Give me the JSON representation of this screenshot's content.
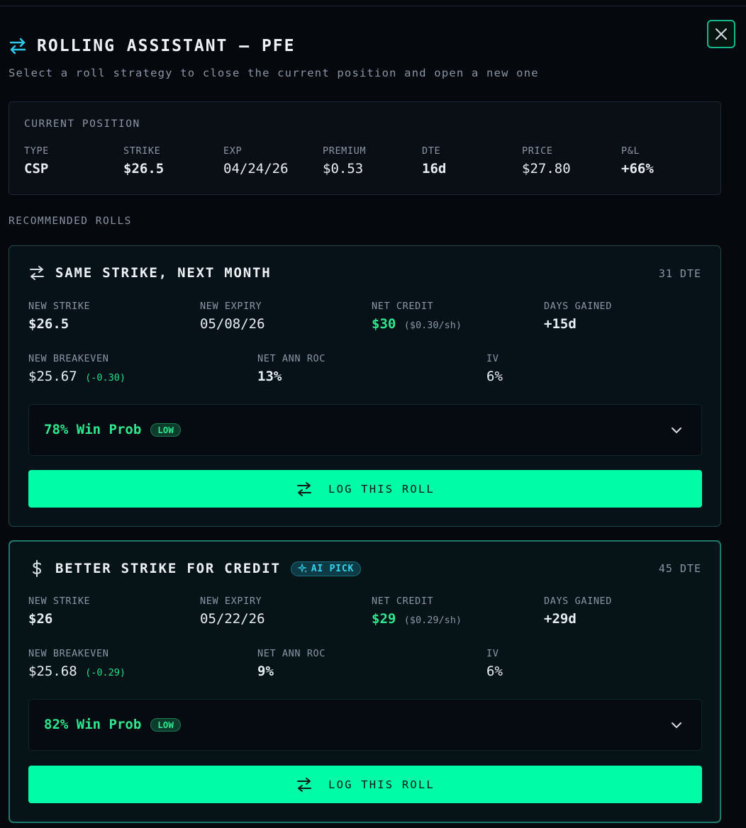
{
  "header": {
    "title": "ROLLING ASSISTANT — PFE",
    "subtitle": "Select a roll strategy to close the current position and open a new one"
  },
  "current_position": {
    "label": "CURRENT POSITION",
    "fields": [
      {
        "key": "TYPE",
        "value": "CSP"
      },
      {
        "key": "STRIKE",
        "value": "$26.5"
      },
      {
        "key": "EXP",
        "value": "04/24/26"
      },
      {
        "key": "PREMIUM",
        "value": "$0.53"
      },
      {
        "key": "DTE",
        "value": "16d"
      },
      {
        "key": "PRICE",
        "value": "$27.80"
      },
      {
        "key": "P&L",
        "value": "+66%"
      }
    ]
  },
  "recommended_label": "RECOMMENDED ROLLS",
  "rolls": [
    {
      "title": "SAME STRIKE, NEXT MONTH",
      "icon": "swap-icon",
      "dte": "31 DTE",
      "new_strike_label": "NEW STRIKE",
      "new_strike": "$26.5",
      "new_expiry_label": "NEW EXPIRY",
      "new_expiry": "05/08/26",
      "net_credit_label": "NET CREDIT",
      "net_credit": "$30",
      "net_credit_sh": "($0.30/sh)",
      "days_gained_label": "DAYS GAINED",
      "days_gained": "+15d",
      "breakeven_label": "NEW BREAKEVEN",
      "breakeven": "$25.67",
      "breakeven_delta": "(-0.30)",
      "roc_label": "NET ANN ROC",
      "roc": "13%",
      "iv_label": "IV",
      "iv": "6%",
      "win_prob": "78% Win Prob",
      "risk": "LOW",
      "button": "LOG THIS ROLL"
    },
    {
      "title": "BETTER STRIKE FOR CREDIT",
      "icon": "dollar-icon",
      "badge": "AI PICK",
      "dte": "45 DTE",
      "new_strike_label": "NEW STRIKE",
      "new_strike": "$26",
      "new_expiry_label": "NEW EXPIRY",
      "new_expiry": "05/22/26",
      "net_credit_label": "NET CREDIT",
      "net_credit": "$29",
      "net_credit_sh": "($0.29/sh)",
      "days_gained_label": "DAYS GAINED",
      "days_gained": "+29d",
      "breakeven_label": "NEW BREAKEVEN",
      "breakeven": "$25.68",
      "breakeven_delta": "(-0.29)",
      "roc_label": "NET ANN ROC",
      "roc": "9%",
      "iv_label": "IV",
      "iv": "6%",
      "win_prob": "82% Win Prob",
      "risk": "LOW",
      "button": "LOG THIS ROLL"
    }
  ],
  "colors": {
    "accent": "#00fca7",
    "positive": "#2ee88f",
    "ai": "#36d2ee",
    "background": "#05080d"
  }
}
